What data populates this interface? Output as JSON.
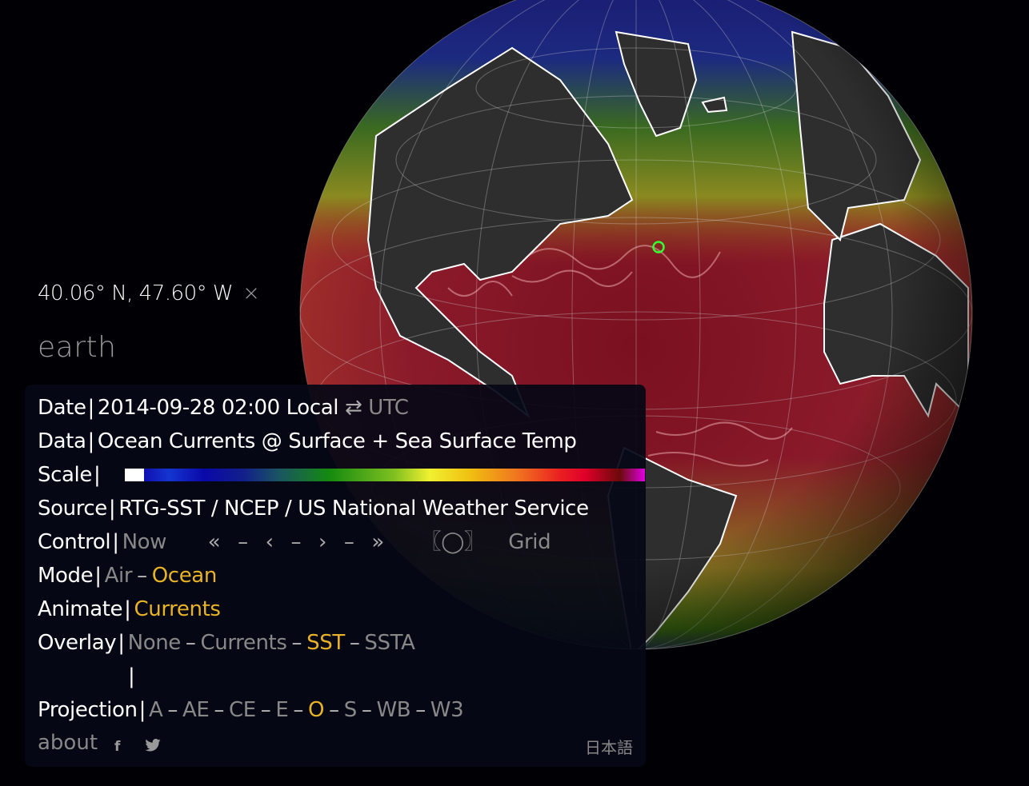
{
  "location": {
    "coordinates": "40.06° N, 47.60° W",
    "close_glyph": "×"
  },
  "brand": "earth",
  "menu": {
    "date": {
      "label": "Date",
      "value": "2014-09-28 02:00 Local",
      "toggle_glyph": "⇄",
      "alt_zone": "UTC"
    },
    "data": {
      "label": "Data",
      "value": "Ocean Currents @ Surface + Sea Surface Temp"
    },
    "scale": {
      "label": "Scale"
    },
    "source": {
      "label": "Source",
      "value": "RTG-SST / NCEP / US National Weather Service"
    },
    "control": {
      "label": "Control",
      "now": "Now",
      "back_fast": "«",
      "back": "‹",
      "forward": "›",
      "forward_fast": "»",
      "dash": "–",
      "orientation": "〖◯〗",
      "grid": "Grid"
    },
    "mode": {
      "label": "Mode",
      "options": [
        {
          "label": "Air",
          "selected": false
        },
        {
          "label": "Ocean",
          "selected": true
        }
      ]
    },
    "animate": {
      "label": "Animate",
      "options": [
        {
          "label": "Currents",
          "selected": true
        }
      ]
    },
    "overlay": {
      "label": "Overlay",
      "options": [
        {
          "label": "None",
          "selected": false
        },
        {
          "label": "Currents",
          "selected": false
        },
        {
          "label": "SST",
          "selected": true
        },
        {
          "label": "SSTA",
          "selected": false
        }
      ]
    },
    "projection": {
      "label": "Projection",
      "options": [
        {
          "label": "A",
          "selected": false
        },
        {
          "label": "AE",
          "selected": false
        },
        {
          "label": "CE",
          "selected": false
        },
        {
          "label": "E",
          "selected": false
        },
        {
          "label": "O",
          "selected": true
        },
        {
          "label": "S",
          "selected": false
        },
        {
          "label": "WB",
          "selected": false
        },
        {
          "label": "W3",
          "selected": false
        }
      ]
    },
    "separator": "|",
    "option_dash": "–",
    "footer": {
      "about": "about",
      "facebook_icon": "f",
      "twitter_icon": "🐦",
      "language": "日本語"
    }
  },
  "colors": {
    "accent": "#e8b325",
    "inactive": "#888888",
    "marker": "#33ff33",
    "land": "#2e2e2e"
  }
}
